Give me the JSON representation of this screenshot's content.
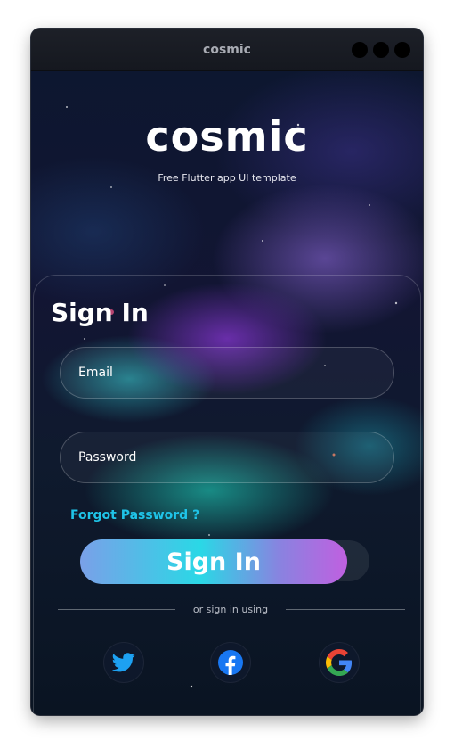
{
  "window": {
    "title": "cosmic"
  },
  "brand": {
    "logo": "cosmic",
    "subtitle": "Free Flutter app UI template"
  },
  "form": {
    "heading": "Sign In",
    "email_placeholder": "Email",
    "password_placeholder": "Password",
    "forgot_label": "Forgot Password ?",
    "submit_label": "Sign In",
    "divider_text": "or sign in using"
  },
  "social": [
    {
      "icon": "twitter-icon",
      "color": "#1da1f2"
    },
    {
      "icon": "facebook-icon",
      "color": "#1877f2"
    },
    {
      "icon": "google-icon",
      "color": "#ea4335"
    }
  ],
  "colors": {
    "accent": "#1fc4e8",
    "button_gradient_start": "#7aa0e8",
    "button_gradient_end": "#c060e0"
  }
}
